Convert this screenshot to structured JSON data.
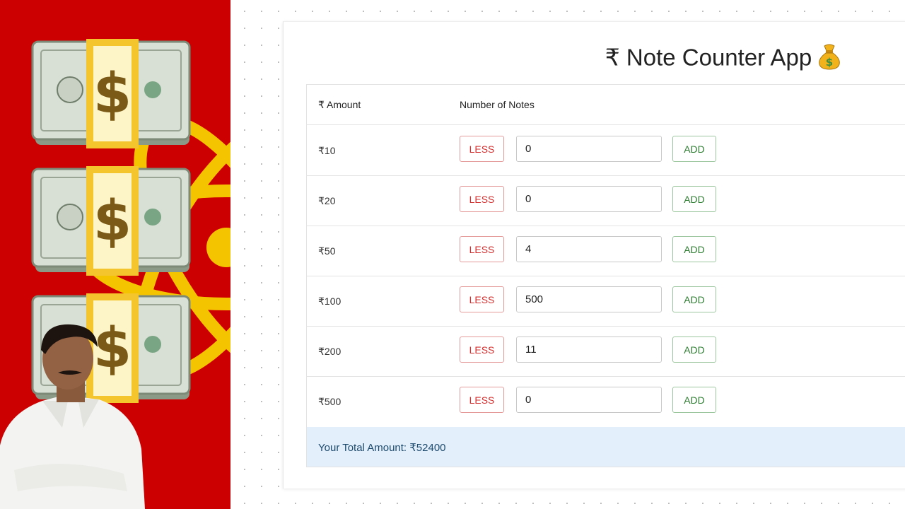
{
  "app": {
    "title": "₹ Note Counter App",
    "title_icon": "money-bag-icon"
  },
  "table": {
    "headers": [
      "₹ Amount",
      "Number of Notes"
    ],
    "rows": [
      {
        "denomination": "₹10",
        "count": "0",
        "less_label": "LESS",
        "add_label": "ADD"
      },
      {
        "denomination": "₹20",
        "count": "0",
        "less_label": "LESS",
        "add_label": "ADD"
      },
      {
        "denomination": "₹50",
        "count": "4",
        "less_label": "LESS",
        "add_label": "ADD"
      },
      {
        "denomination": "₹100",
        "count": "500",
        "less_label": "LESS",
        "add_label": "ADD"
      },
      {
        "denomination": "₹200",
        "count": "11",
        "less_label": "LESS",
        "add_label": "ADD"
      },
      {
        "denomination": "₹500",
        "count": "0",
        "less_label": "LESS",
        "add_label": "ADD"
      }
    ]
  },
  "total": {
    "label": "Your Total Amount: ₹52400"
  },
  "thumbnail": {
    "icons": [
      "money-stack-icon",
      "money-stack-icon",
      "money-stack-icon",
      "react-logo-icon",
      "person-photo"
    ],
    "background_color": "#cc0000",
    "accent_color": "#f5c400"
  },
  "colors": {
    "less": "#d32f2f",
    "add": "#2e7d32",
    "total_bg": "#e3f0fb"
  }
}
